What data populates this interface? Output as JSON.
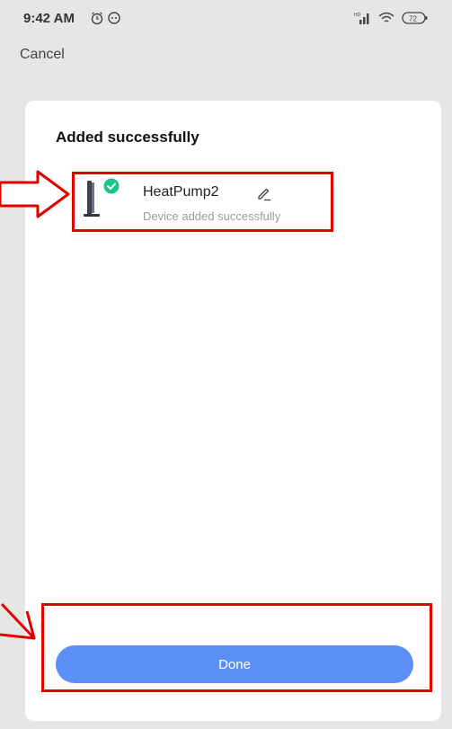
{
  "status_bar": {
    "time": "9:42 AM",
    "battery": "72"
  },
  "nav": {
    "cancel_label": "Cancel"
  },
  "card": {
    "title": "Added successfully",
    "device": {
      "name": "HeatPump2",
      "status": "Device added successfully",
      "icon": "heat-pump-device"
    },
    "done_label": "Done"
  },
  "colors": {
    "primary_button": "#5b8ef7",
    "success_badge": "#1cc58a",
    "annotation": "#e00000"
  }
}
